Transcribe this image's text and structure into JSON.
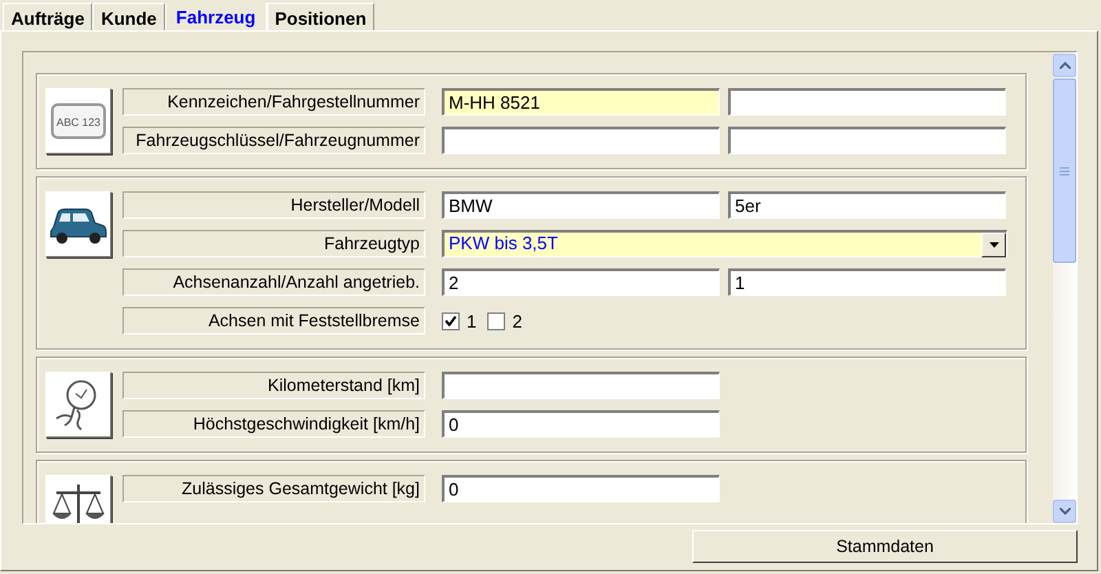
{
  "tabs": [
    {
      "label": "Aufträge",
      "selected": false
    },
    {
      "label": "Kunde",
      "selected": false
    },
    {
      "label": "Fahrzeug",
      "selected": true
    },
    {
      "label": "Positionen",
      "selected": false
    }
  ],
  "sections": [
    {
      "kind": "plate",
      "icon_text": "ABC 123",
      "rows": [
        {
          "label": "Kennzeichen/Fahrgestellnummer",
          "kind": "pair",
          "fields": [
            {
              "value": "M-HH 8521",
              "highlighted": true
            },
            {
              "highlighted": false
            }
          ]
        },
        {
          "label": "Fahrzeugschlüssel/Fahrzeugnummer",
          "kind": "pair",
          "fields": [
            {
              "highlighted": false
            },
            {
              "highlighted": false
            }
          ]
        }
      ]
    },
    {
      "kind": "car",
      "rows": [
        {
          "label": "Hersteller/Modell",
          "kind": "pair",
          "fields": [
            {
              "value": "BMW",
              "highlighted": false
            },
            {
              "value": "5er",
              "highlighted": false
            }
          ]
        },
        {
          "label": "Fahrzeugtyp",
          "kind": "select",
          "value": "PKW bis 3,5T",
          "highlighted": true
        },
        {
          "label": "Achsenanzahl/Anzahl angetrieb.",
          "kind": "pair",
          "fields": [
            {
              "value": "2",
              "highlighted": false
            },
            {
              "value": "1",
              "highlighted": false
            }
          ]
        },
        {
          "label": "Achsen mit Feststellbremse",
          "kind": "checks",
          "items": [
            {
              "label": "1",
              "checked": true
            },
            {
              "label": "2",
              "checked": false
            }
          ]
        }
      ]
    },
    {
      "kind": "gauge",
      "rows": [
        {
          "label": "Kilometerstand [km]",
          "kind": "single",
          "fields": [
            {
              "highlighted": false
            }
          ]
        },
        {
          "label": "Höchstgeschwindigkeit [km/h]",
          "kind": "single",
          "fields": [
            {
              "value": "0",
              "highlighted": false
            }
          ]
        }
      ]
    },
    {
      "kind": "scale",
      "rows": [
        {
          "label": "Zulässiges Gesamtgewicht [kg]",
          "kind": "single",
          "fields": [
            {
              "value": "0",
              "highlighted": false
            }
          ]
        }
      ]
    }
  ],
  "footer_button": "Stammdaten"
}
